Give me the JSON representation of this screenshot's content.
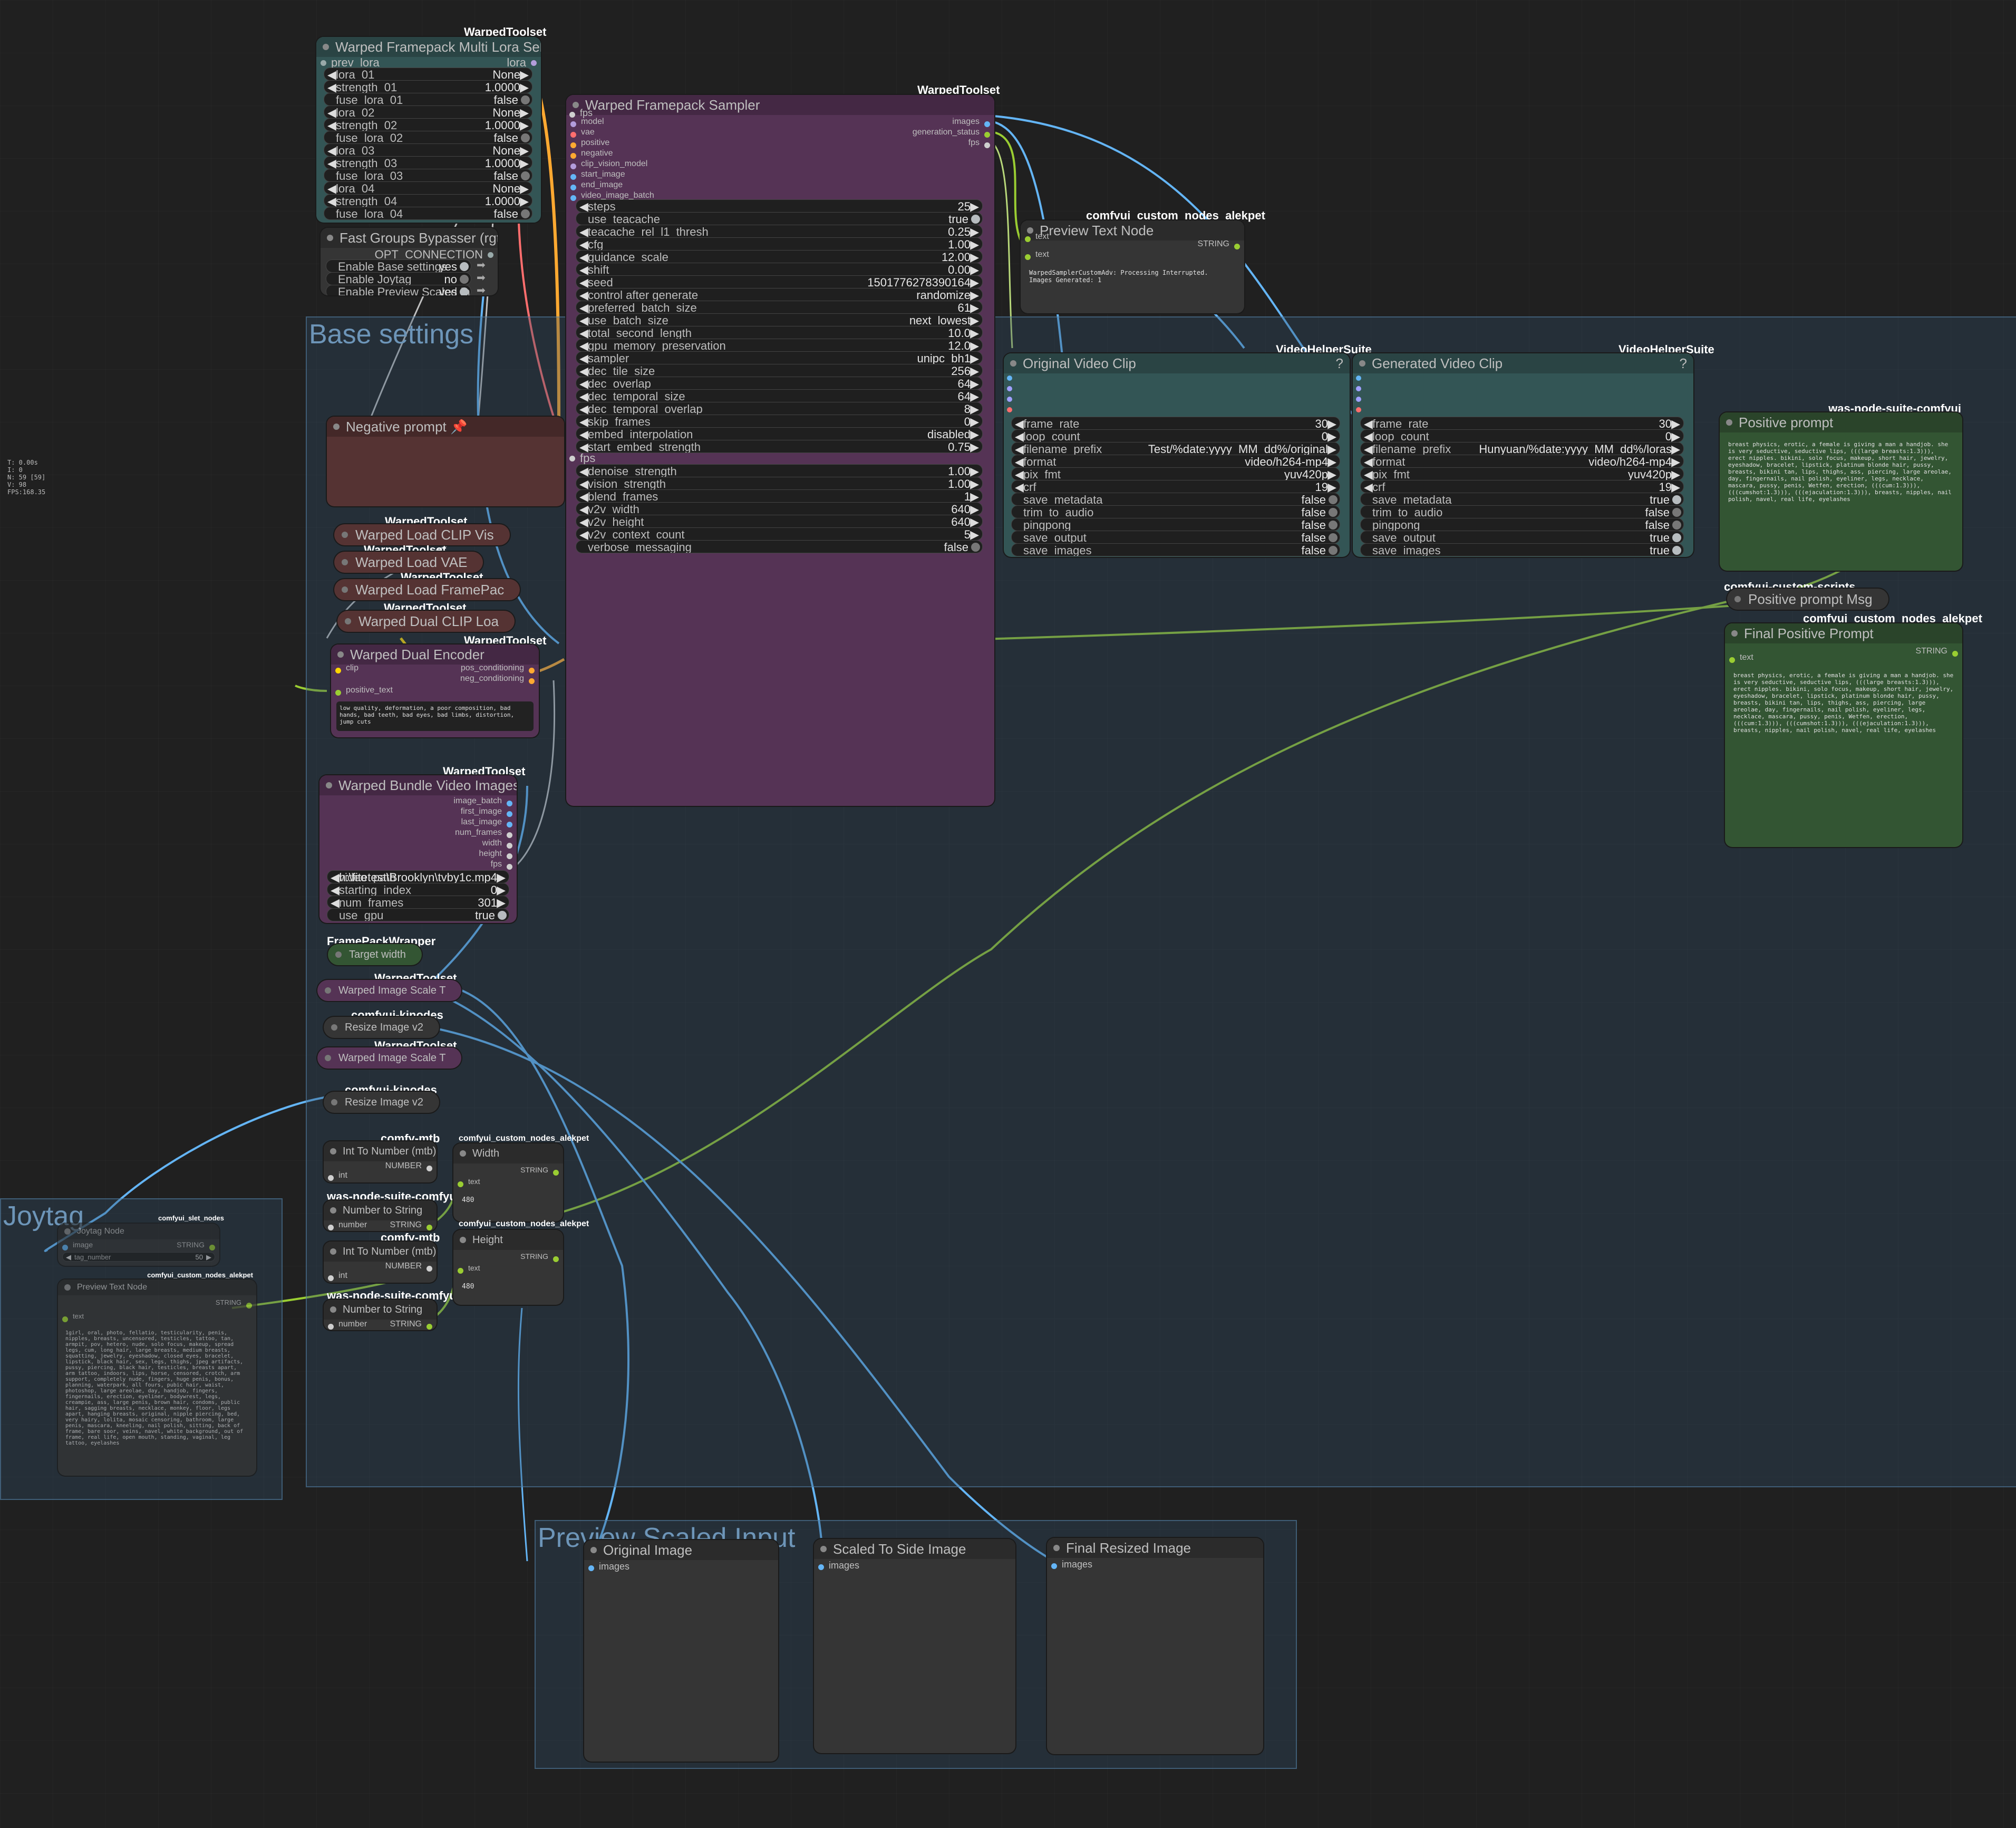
{
  "stats": [
    "T: 0.00s",
    "I: 0",
    "N: 59 [59]",
    "V: 98",
    "FPS:168.35"
  ],
  "groups": {
    "base": "Base settings",
    "joytag": "Joytag",
    "preview": "Preview Scaled Input"
  },
  "lora": {
    "badge": "WarpedToolset",
    "title": "Warped Framepack Multi Lora Select",
    "in_prev": "prev_lora",
    "out_lora": "lora",
    "rows": [
      {
        "l": "lora_01",
        "v": "None"
      },
      {
        "l": "strength_01",
        "v": "1.0000"
      },
      {
        "l": "fuse_lora_01",
        "v": "false"
      },
      {
        "l": "lora_02",
        "v": "None"
      },
      {
        "l": "strength_02",
        "v": "1.0000"
      },
      {
        "l": "fuse_lora_02",
        "v": "false"
      },
      {
        "l": "lora_03",
        "v": "None"
      },
      {
        "l": "strength_03",
        "v": "1.0000"
      },
      {
        "l": "fuse_lora_03",
        "v": "false"
      },
      {
        "l": "lora_04",
        "v": "None"
      },
      {
        "l": "strength_04",
        "v": "1.0000"
      },
      {
        "l": "fuse_lora_04",
        "v": "false"
      }
    ]
  },
  "bypasser": {
    "title": "Fast Groups Bypasser (rgthree)",
    "out": "OPT_CONNECTION",
    "rows": [
      {
        "l": "Enable Base settings",
        "v": "yes"
      },
      {
        "l": "Enable Joytag",
        "v": "no"
      },
      {
        "l": "Enable Preview Scaled Input",
        "v": "yes"
      }
    ]
  },
  "sampler": {
    "badge": "WarpedToolset",
    "title": "Warped Framepack Sampler",
    "fps_in": "fps",
    "inputs": [
      "model",
      "vae",
      "positive",
      "negative",
      "clip_vision_model",
      "start_image",
      "end_image",
      "video_image_batch"
    ],
    "outputs": [
      "images",
      "generation_status",
      "fps"
    ],
    "rows": [
      {
        "l": "steps",
        "v": "25"
      },
      {
        "l": "use_teacache",
        "v": "true"
      },
      {
        "l": "teacache_rel_l1_thresh",
        "v": "0.25"
      },
      {
        "l": "cfg",
        "v": "1.00"
      },
      {
        "l": "guidance_scale",
        "v": "12.00"
      },
      {
        "l": "shift",
        "v": "0.00"
      },
      {
        "l": "seed",
        "v": "1501776278390164"
      },
      {
        "l": "control after generate",
        "v": "randomize"
      },
      {
        "l": "preferred_batch_size",
        "v": "61"
      },
      {
        "l": "use_batch_size",
        "v": "next_lowest"
      },
      {
        "l": "total_second_length",
        "v": "10.0"
      },
      {
        "l": "gpu_memory_preservation",
        "v": "12.0"
      },
      {
        "l": "sampler",
        "v": "unipc_bh1"
      },
      {
        "l": "dec_tile_size",
        "v": "256"
      },
      {
        "l": "dec_overlap",
        "v": "64"
      },
      {
        "l": "dec_temporal_size",
        "v": "64"
      },
      {
        "l": "dec_temporal_overlap",
        "v": "8"
      },
      {
        "l": "skip_frames",
        "v": "0"
      },
      {
        "l": "embed_interpolation",
        "v": "disabled"
      },
      {
        "l": "start_embed_strength",
        "v": "0.75"
      }
    ],
    "fps_row": "fps",
    "rows2": [
      {
        "l": "denoise_strength",
        "v": "1.00"
      },
      {
        "l": "vision_strength",
        "v": "1.00"
      },
      {
        "l": "blend_frames",
        "v": "1"
      },
      {
        "l": "v2v_width",
        "v": "640"
      },
      {
        "l": "v2v_height",
        "v": "640"
      },
      {
        "l": "v2v_context_count",
        "v": "5"
      },
      {
        "l": "verbose_messaging",
        "v": "false"
      }
    ]
  },
  "preview_text_top": {
    "badge": "comfyui_custom_nodes_alekpet",
    "title": "Preview Text Node",
    "in_text": "text",
    "out": "STRING",
    "in_text2": "text",
    "content": "WarpedSamplerCustomAdv: Processing Interrupted.\nImages Generated: 1"
  },
  "orig_video": {
    "badge": "VideoHelperSuite",
    "title": "Original Video Clip",
    "rows": [
      {
        "l": "frame_rate",
        "v": "30"
      },
      {
        "l": "loop_count",
        "v": "0"
      },
      {
        "l": "filename_prefix",
        "v": "Test/%date:yyyy_MM_dd%/original"
      },
      {
        "l": "format",
        "v": "video/h264-mp4"
      },
      {
        "l": "pix_fmt",
        "v": "yuv420p"
      },
      {
        "l": "crf",
        "v": "19"
      },
      {
        "l": "save_metadata",
        "v": "false"
      },
      {
        "l": "trim_to_audio",
        "v": "false"
      },
      {
        "l": "pingpong",
        "v": "false"
      },
      {
        "l": "save_output",
        "v": "false"
      },
      {
        "l": "save_images",
        "v": "false"
      }
    ]
  },
  "gen_video": {
    "badge": "VideoHelperSuite",
    "title": "Generated Video Clip",
    "rows": [
      {
        "l": "frame_rate",
        "v": "30"
      },
      {
        "l": "loop_count",
        "v": "0"
      },
      {
        "l": "filename_prefix",
        "v": "Hunyuan/%date:yyyy_MM_dd%/loras"
      },
      {
        "l": "format",
        "v": "video/h264-mp4"
      },
      {
        "l": "pix_fmt",
        "v": "yuv420p"
      },
      {
        "l": "crf",
        "v": "19"
      },
      {
        "l": "save_metadata",
        "v": "true"
      },
      {
        "l": "trim_to_audio",
        "v": "false"
      },
      {
        "l": "pingpong",
        "v": "false"
      },
      {
        "l": "save_output",
        "v": "true"
      },
      {
        "l": "save_images",
        "v": "true"
      }
    ]
  },
  "pos_prompt": {
    "badge": "was-node-suite-comfyui",
    "title": "Positive prompt",
    "content": "breast physics, erotic, a female is giving a man a handjob. she is very seductive, seductive lips, (((large breasts:1.3))), erect nipples. bikini, solo focus, makeup, short hair, jewelry, eyeshadow, bracelet, lipstick, platinum blonde hair, pussy, breasts, bikini tan, lips, thighs, ass, piercing, large areolae, day, fingernails, nail polish, eyeliner, legs, necklace, mascara, pussy, penis, Wetfen, erection, (((cum:1.3))), (((cumshot:1.3))), (((ejaculation:1.3))), breasts, nipples, nail polish, navel, real life, eyelashes"
  },
  "pos_msg": {
    "badge": "comfyui-custom-scripts",
    "title": "Positive prompt Msg"
  },
  "final_pos": {
    "badge": "comfyui_custom_nodes_alekpet",
    "title": "Final Positive Prompt",
    "out": "STRING",
    "in_text": "text",
    "content": "breast physics, erotic, a female is giving a man a handjob. she is very seductive, seductive lips, (((large breasts:1.3))), erect nipples. bikini, solo focus, makeup, short hair, jewelry, eyeshadow, bracelet, lipstick, platinum blonde hair, pussy, breasts, bikini tan, lips, thighs, ass, piercing, large areolae, day, fingernails, nail polish, eyeliner, legs, necklace, mascara, pussy, penis, Wetfen, erection, (((cum:1.3))), (((cumshot:1.3))), (((ejaculation:1.3))), breasts, nipples, nail polish, navel, real life, eyelashes"
  },
  "neg_prompt": {
    "title": "Negative prompt 📌"
  },
  "small_nodes": {
    "clipvis": {
      "badge": "WarpedToolset",
      "title": "Warped Load CLIP Vis"
    },
    "vae": {
      "badge": "WarpedToolset",
      "title": "Warped Load VAE"
    },
    "framepack": {
      "badge": "WarpedToolset",
      "title": "Warped Load FramePac"
    },
    "dualclip": {
      "badge": "WarpedToolset",
      "title": "Warped Dual CLIP Loa"
    }
  },
  "dual_encoder": {
    "badge": "WarpedToolset",
    "title": "Warped Dual Encoder",
    "in_clip": "clip",
    "in_pos": "positive_text",
    "out1": "pos_conditioning",
    "out2": "neg_conditioning",
    "content": "low quality, deformation, a poor composition, bad hands, bad teeth, bad eyes, bad limbs, distortion, jump cuts"
  },
  "bundle": {
    "badge": "WarpedToolset",
    "title": "Warped Bundle Video Images",
    "outputs": [
      "image_batch",
      "first_image",
      "last_image",
      "num_frames",
      "width",
      "height",
      "fps"
    ],
    "rows": [
      {
        "l": "video_path",
        "v": "h:\\fitetest\\Brooklyn\\tvby1c.mp4"
      },
      {
        "l": "starting_index",
        "v": "0"
      },
      {
        "l": "num_frames",
        "v": "301"
      },
      {
        "l": "use_gpu",
        "v": "true"
      }
    ]
  },
  "scale_nodes": {
    "target": {
      "badge": "FramePackWrapper",
      "title": "Target width"
    },
    "scale1": {
      "badge": "WarpedToolset",
      "title": "Warped Image Scale T"
    },
    "resize1": {
      "badge": "comfyui-kjnodes",
      "title": "Resize Image v2"
    },
    "scale2": {
      "badge": "WarpedToolset",
      "title": "Warped Image Scale T"
    },
    "resize2": {
      "badge": "comfyui-kjnodes",
      "title": "Resize Image v2"
    }
  },
  "int2num1": {
    "badge": "comfy-mtb",
    "title": "Int To Number (mtb)",
    "out": "NUMBER",
    "in": "int"
  },
  "num2str1": {
    "badge": "was-node-suite-comfyui",
    "title": "Number to String",
    "in": "number",
    "out": "STRING"
  },
  "int2num2": {
    "badge": "comfy-mtb",
    "title": "Int To Number (mtb)",
    "out": "NUMBER",
    "in": "int"
  },
  "num2str2": {
    "badge": "was-node-suite-comfyui",
    "title": "Number to String",
    "in": "number",
    "out": "STRING"
  },
  "width_node": {
    "badge": "comfyui_custom_nodes_alekpet",
    "title": "Width",
    "out": "STRING",
    "in": "text",
    "value": "480"
  },
  "height_node": {
    "badge": "comfyui_custom_nodes_alekpet",
    "title": "Height",
    "out": "STRING",
    "in": "text",
    "value": "480"
  },
  "joytag_node": {
    "badge": "comfyui_slet_nodes",
    "title": "Joytag Node",
    "in": "image",
    "out": "STRING",
    "widget_label": "tag_number",
    "widget_value": "50"
  },
  "joytag_preview": {
    "badge": "comfyui_custom_nodes_alekpet",
    "title": "Preview Text Node",
    "out": "STRING",
    "in": "text",
    "content": "1girl, oral, photo, fellatio, testicularity, penis, nipples, breasts, uncensored, testicles, tattoo, tan, armpit, pov, hetero, nude, solo focus, makeup, spread legs, cum, long hair, large breasts, medium breasts, squatting, jewelry, eyeshadow, closed eyes, bracelet, lipstick, black hair, sex, legs, thighs, jpeg artifacts, pussy, piercing, black hair, testicles, breasts apart, arm tattoo, indoors, lips, horse, censored, crotch, arm support, completely nude, fingers, huge penis, bonus, planning, waterpark, all fours, pubic hair, waist, photoshop, large areolae, day, handjob, fingers, fingernails, erection, eyeliner, bodywrest, legs, creampie, ass, large penis, brown hair, condoms, public hair, sagging breasts, necklace, monkey, floor, legs apart, hanging breasts, original, nipple piercing, bed, very hairy, lolita, mosaic censoring, bathroom, large penis, mascara, kneeling, nail polish, sitting, back of frame, bare soor, veins, navel, white background, out of frame, real life, open mouth, standing, vaginal, leg tattoo, eyelashes"
  },
  "preview_scaled": {
    "orig": {
      "title": "Original Image",
      "in": "images"
    },
    "side": {
      "title": "Scaled To Side Image",
      "in": "images"
    },
    "final": {
      "title": "Final Resized Image",
      "in": "images"
    }
  }
}
